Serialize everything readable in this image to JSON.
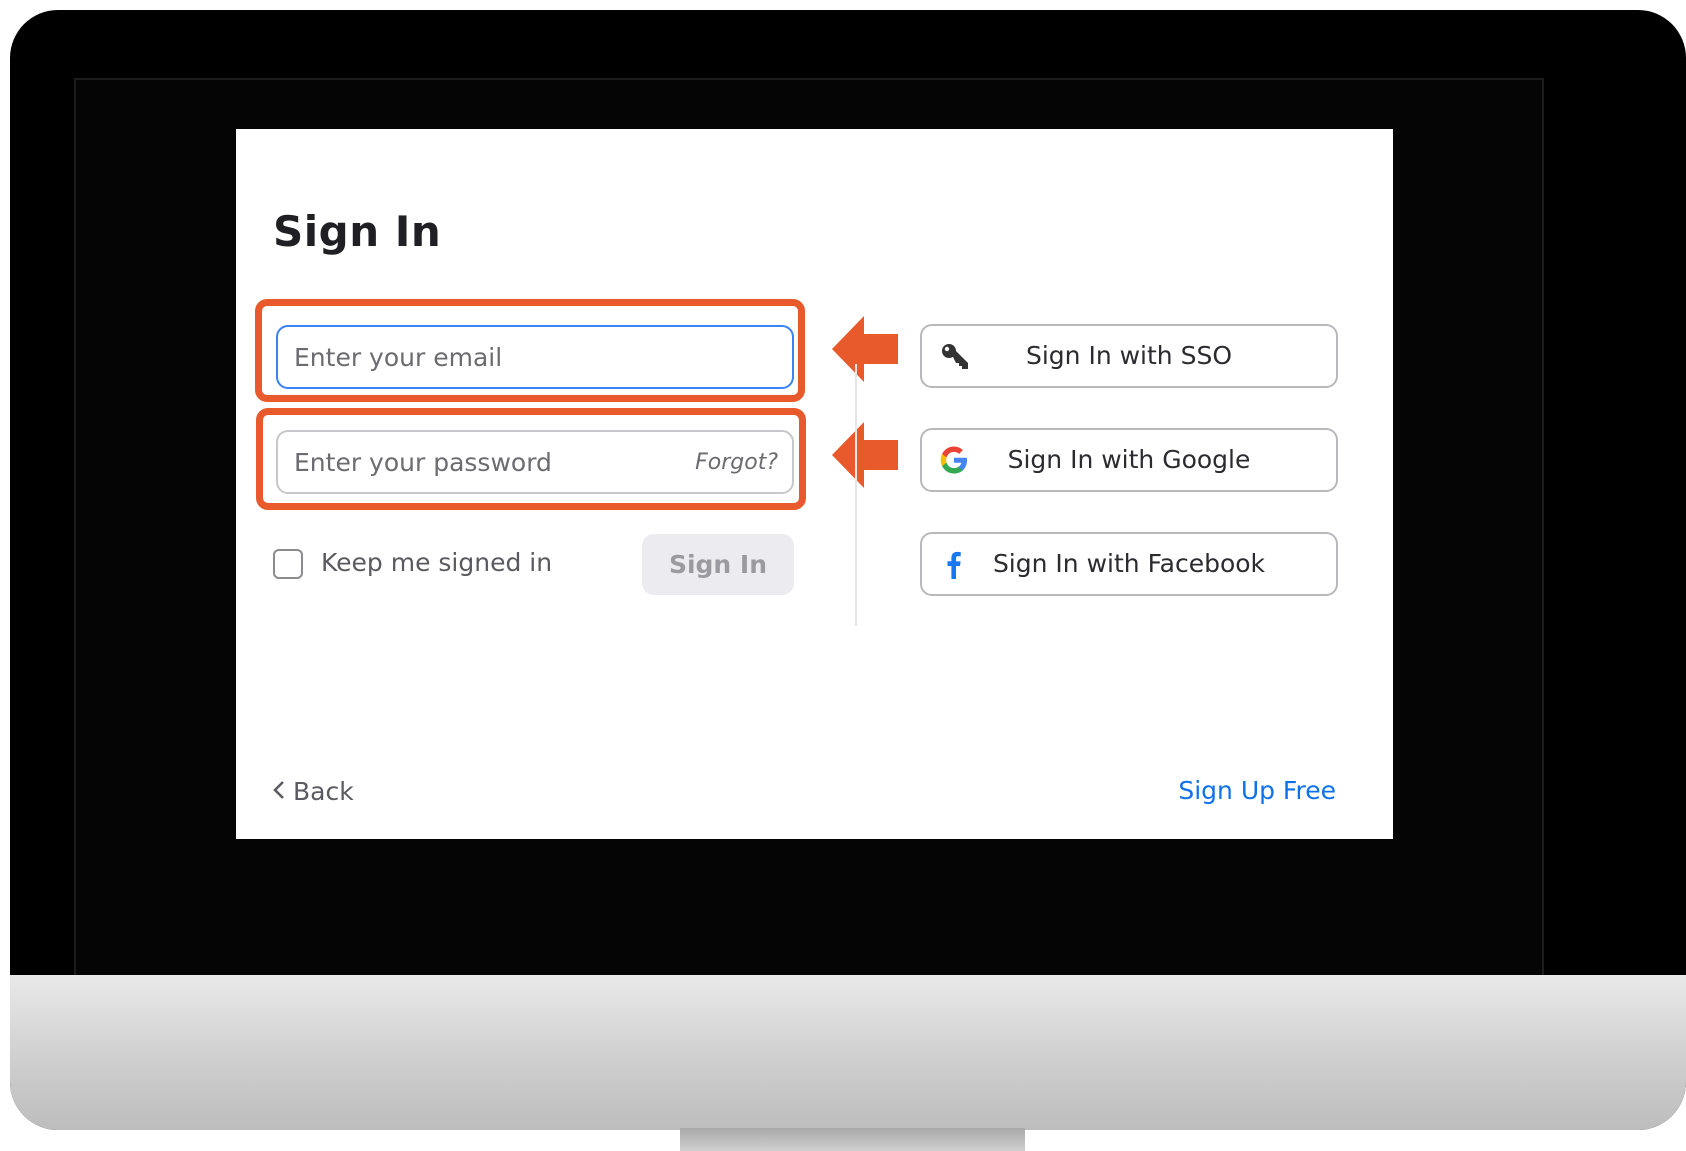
{
  "signin": {
    "title": "Sign In",
    "email_placeholder": "Enter your email",
    "password_placeholder": "Enter your password",
    "forgot_label": "Forgot?",
    "keep_signed_in_label": "Keep me signed in",
    "signin_button_label": "Sign In"
  },
  "sso_options": {
    "sso_label": "Sign In with SSO",
    "google_label": "Sign In with Google",
    "facebook_label": "Sign In with Facebook"
  },
  "footer": {
    "back_label": "Back",
    "back_icon": "chevron-left-icon",
    "signup_label": "Sign Up Free"
  },
  "icons": {
    "sso": "key-icon",
    "google": "google-icon",
    "facebook": "facebook-icon",
    "callout": "arrow-left-icon"
  },
  "colors": {
    "highlight": "#e85a2c",
    "link": "#0e72ed",
    "focus_border": "#3b82f6",
    "google_blue": "#4285F4",
    "google_red": "#EA4335",
    "google_yellow": "#FBBC05",
    "google_green": "#34A853",
    "facebook_blue": "#1877F2"
  }
}
